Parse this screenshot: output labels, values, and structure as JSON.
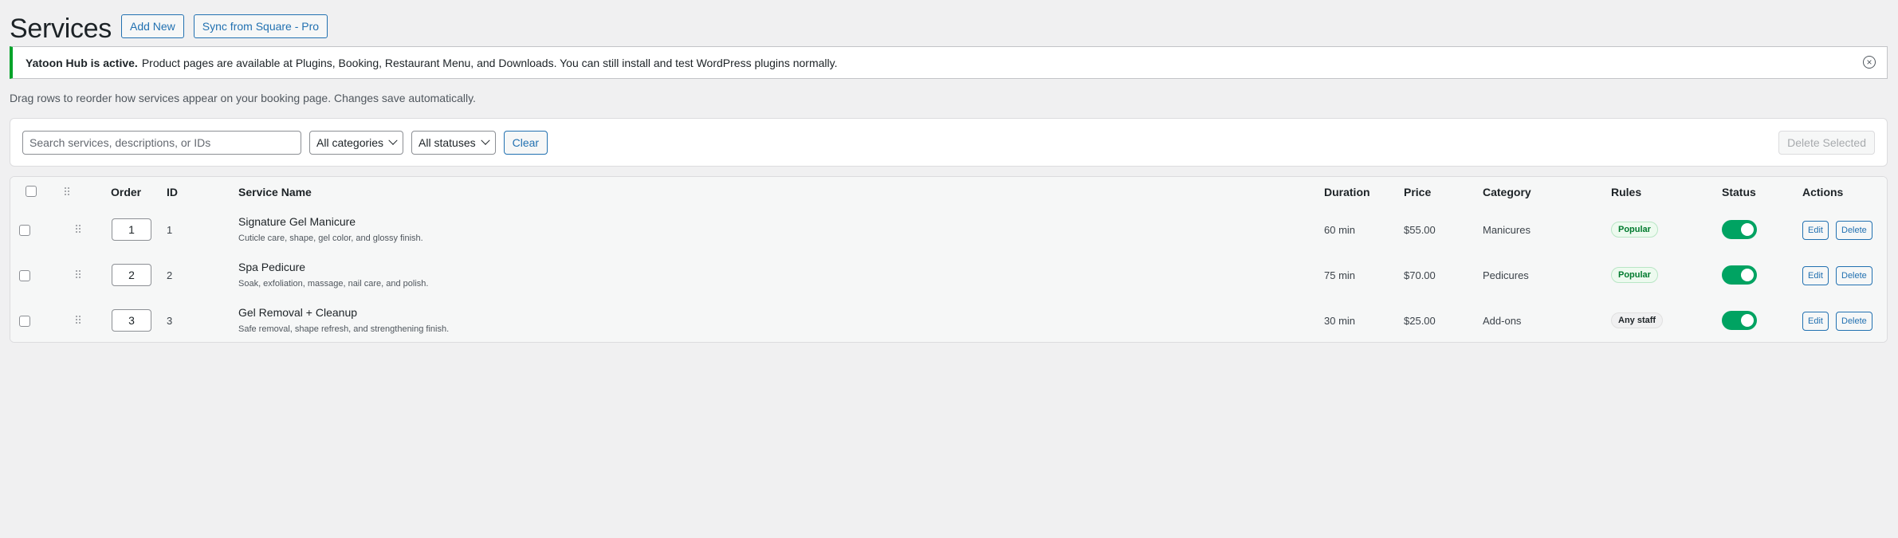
{
  "header": {
    "title": "Services",
    "add_new_label": "Add New",
    "sync_label": "Sync from Square - Pro"
  },
  "notice": {
    "bold": "Yatoon Hub is active.",
    "text": "Product pages are available at Plugins, Booking, Restaurant Menu, and Downloads. You can still install and test WordPress plugins normally.",
    "dismiss_icon": "close-circle-icon"
  },
  "hint": "Drag rows to reorder how services appear on your booking page. Changes save automatically.",
  "filters": {
    "search_placeholder": "Search services, descriptions, or IDs",
    "search_value": "",
    "category_selected": "All categories",
    "status_selected": "All statuses",
    "clear_label": "Clear",
    "delete_selected_label": "Delete Selected"
  },
  "table": {
    "columns": {
      "order": "Order",
      "id": "ID",
      "name": "Service Name",
      "duration": "Duration",
      "price": "Price",
      "category": "Category",
      "rules": "Rules",
      "status": "Status",
      "actions": "Actions"
    },
    "rows": [
      {
        "order": "1",
        "id": "1",
        "name": "Signature Gel Manicure",
        "description": "Cuticle care, shape, gel color, and glossy finish.",
        "duration": "60 min",
        "price": "$55.00",
        "category": "Manicures",
        "rule": "Popular",
        "status_on": true,
        "edit_label": "Edit",
        "delete_label": "Delete"
      },
      {
        "order": "2",
        "id": "2",
        "name": "Spa Pedicure",
        "description": "Soak, exfoliation, massage, nail care, and polish.",
        "duration": "75 min",
        "price": "$70.00",
        "category": "Pedicures",
        "rule": "Popular",
        "status_on": true,
        "edit_label": "Edit",
        "delete_label": "Delete"
      },
      {
        "order": "3",
        "id": "3",
        "name": "Gel Removal + Cleanup",
        "description": "Safe removal, shape refresh, and strengthening finish.",
        "duration": "30 min",
        "price": "$25.00",
        "category": "Add-ons",
        "rule": "Any staff",
        "status_on": true,
        "edit_label": "Edit",
        "delete_label": "Delete"
      }
    ]
  },
  "colors": {
    "accent": "#2271b1",
    "success": "#00a32a",
    "toggle_on": "#00a362"
  }
}
